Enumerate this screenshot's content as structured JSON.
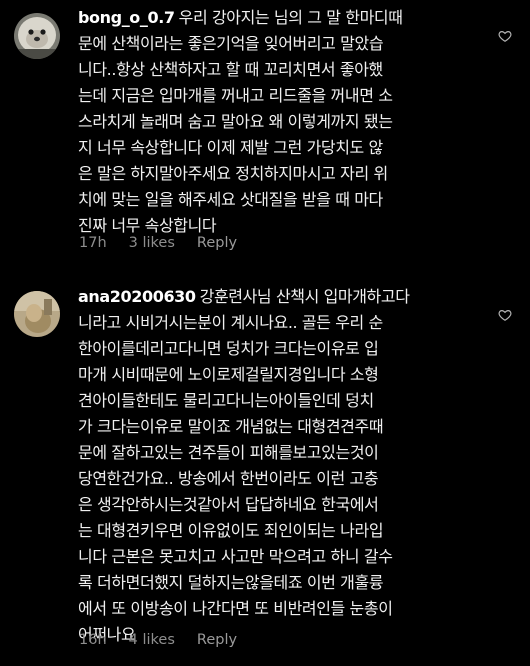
{
  "comments": [
    {
      "username": "bong_o_0.7",
      "lines": [
        "우리 강아지는 님의 그 말 한마디때",
        "문에 산책이라는 좋은기억을 잊어버리고 말았습",
        "니다..항상 산책하자고 할 때 꼬리치면서 좋아했",
        "는데 지금은 입마개를 꺼내고 리드줄을 꺼내면 소",
        "스라치게 놀래며 숨고 말아요 왜 이렇게까지 됐는",
        "지 너무 속상합니다 이제 제발 그런 가당치도 않",
        "은 말은 하지말아주세요 정치하지마시고 자리 위",
        "치에 맞는 일을 해주세요 삿대질을 받을 때 마다",
        "진짜 너무 속상합니다"
      ],
      "time": "17h",
      "likes": "3 likes",
      "reply": "Reply"
    },
    {
      "username": "ana20200630",
      "lines": [
        "강훈련사님 산책시 입마개하고다",
        "니라고 시비거시는분이 계시나요.. 골든 우리 순",
        "한아이를데리고다니면 덩치가 크다는이유로 입",
        "마개 시비때문에 노이로제걸릴지경입니다  소형",
        "견아이들한테도 물리고다니는아이들인데 덩치",
        "가 크다는이유로 말이죠 개념없는 대형견견주때",
        "문에 잘하고있는 견주들이 피해를보고있는것이",
        "당연한건가요.. 방송에서 한번이라도 이런 고충",
        "은 생각안하시는것같아서 답답하네요 한국에서",
        "는 대형견키우면 이유없이도 죄인이되는 나라입",
        "니다 근본은 못고치고 사고만 막으려고 하니 갈수",
        "록 더하면더했지 덜하지는않을테죠 이번 개훌륭",
        "에서 또 이방송이 나간다면 또 비반려인들 눈총이",
        "어쩌나요"
      ],
      "time": "16h",
      "likes": "4 likes",
      "reply": "Reply"
    }
  ]
}
